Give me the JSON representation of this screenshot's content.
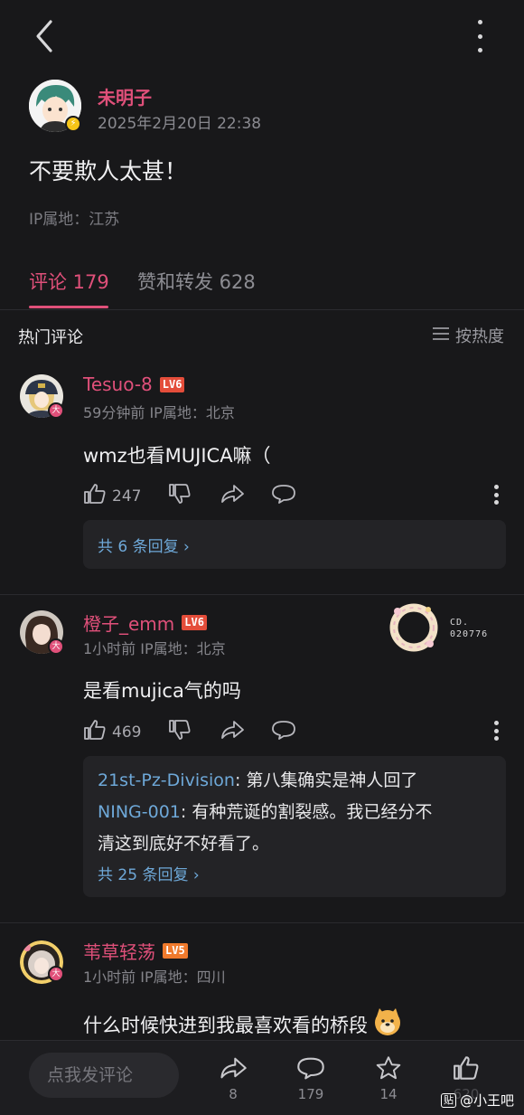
{
  "post": {
    "author": "未明子",
    "date": "2025年2月20日 22:38",
    "content": "不要欺人太甚！",
    "ip": "IP属地：江苏"
  },
  "tabs": [
    {
      "label": "评论 179",
      "active": true
    },
    {
      "label": "赞和转发 628",
      "active": false
    }
  ],
  "hot": {
    "title": "热门评论",
    "sort": "按热度"
  },
  "comments": [
    {
      "name": "Tesuo-8",
      "level": "LV6",
      "badge": "大",
      "meta": "59分钟前 IP属地：北京",
      "text": "wmz也看MUJICA嘛（",
      "likes": "247",
      "replies_more": "共 6 条回复 ›"
    },
    {
      "name": "橙子_emm",
      "level": "LV6",
      "badge": "大",
      "meta": "1小时前 IP属地：北京",
      "text": "是看mujica气的吗",
      "likes": "469",
      "deco_code_line1": "CD.",
      "deco_code_line2": "020776",
      "replies": [
        {
          "user": "21st-Pz-Division",
          "text": ": 第八集确实是神人回了"
        },
        {
          "user": "NING-001",
          "text": ": 有种荒诞的割裂感。我已经分不",
          "text2": "清这到底好不好看了。"
        }
      ],
      "replies_more": "共 25 条回复 ›"
    },
    {
      "name": "苇草轻荡",
      "level": "LV5",
      "badge": "大",
      "meta": "1小时前 IP属地：四川",
      "text": "什么时候快进到我最喜欢看的桥段"
    }
  ],
  "bottom": {
    "input_placeholder": "点我发评论",
    "share_count": "8",
    "comment_count": "179",
    "fav_count": "14",
    "like_count": "620"
  },
  "watermark": {
    "icon_text": "贴",
    "text": "@小王吧"
  },
  "colors": {
    "accent": "#e0507a",
    "link": "#6ea8d8",
    "background": "#18181a"
  }
}
